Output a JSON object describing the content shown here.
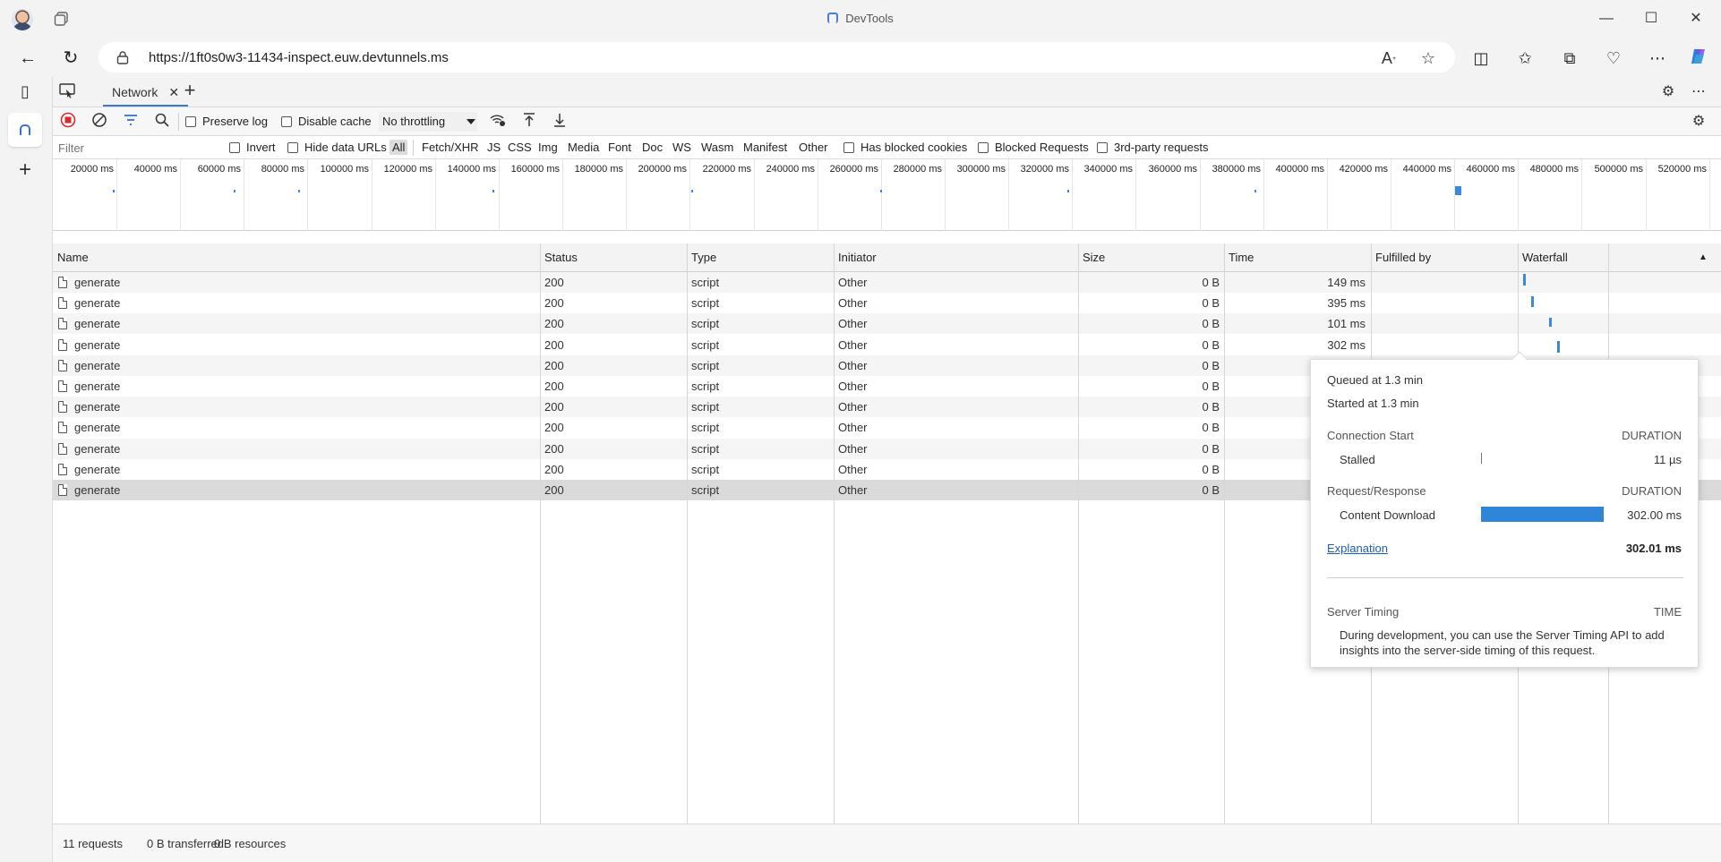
{
  "window": {
    "title": "DevTools"
  },
  "address": {
    "url": "https://1ft0s0w3-11434-inspect.euw.devtunnels.ms"
  },
  "devtools": {
    "tab_label": "Network",
    "toolbar": {
      "preserve_log": "Preserve log",
      "disable_cache": "Disable cache",
      "throttling": "No throttling"
    },
    "filter": {
      "placeholder": "Filter",
      "invert": "Invert",
      "hide_data_urls": "Hide data URLs",
      "types": [
        "All",
        "Fetch/XHR",
        "JS",
        "CSS",
        "Img",
        "Media",
        "Font",
        "Doc",
        "WS",
        "Wasm",
        "Manifest",
        "Other"
      ],
      "has_blocked_cookies": "Has blocked cookies",
      "blocked_requests": "Blocked Requests",
      "third_party": "3rd-party requests"
    },
    "overview_ticks": [
      "20000 ms",
      "40000 ms",
      "60000 ms",
      "80000 ms",
      "100000 ms",
      "120000 ms",
      "140000 ms",
      "160000 ms",
      "180000 ms",
      "200000 ms",
      "220000 ms",
      "240000 ms",
      "260000 ms",
      "280000 ms",
      "300000 ms",
      "320000 ms",
      "340000 ms",
      "360000 ms",
      "380000 ms",
      "400000 ms",
      "420000 ms",
      "440000 ms",
      "460000 ms",
      "480000 ms",
      "500000 ms",
      "520000 ms"
    ],
    "columns": [
      "Name",
      "Status",
      "Type",
      "Initiator",
      "Size",
      "Time",
      "Fulfilled by",
      "Waterfall"
    ],
    "rows": [
      {
        "name": "generate",
        "status": "200",
        "type": "script",
        "initiator": "Other",
        "size": "0 B",
        "time": "149 ms"
      },
      {
        "name": "generate",
        "status": "200",
        "type": "script",
        "initiator": "Other",
        "size": "0 B",
        "time": "395 ms"
      },
      {
        "name": "generate",
        "status": "200",
        "type": "script",
        "initiator": "Other",
        "size": "0 B",
        "time": "101 ms"
      },
      {
        "name": "generate",
        "status": "200",
        "type": "script",
        "initiator": "Other",
        "size": "0 B",
        "time": "302 ms"
      },
      {
        "name": "generate",
        "status": "200",
        "type": "script",
        "initiator": "Other",
        "size": "0 B",
        "time": ""
      },
      {
        "name": "generate",
        "status": "200",
        "type": "script",
        "initiator": "Other",
        "size": "0 B",
        "time": ""
      },
      {
        "name": "generate",
        "status": "200",
        "type": "script",
        "initiator": "Other",
        "size": "0 B",
        "time": ""
      },
      {
        "name": "generate",
        "status": "200",
        "type": "script",
        "initiator": "Other",
        "size": "0 B",
        "time": ""
      },
      {
        "name": "generate",
        "status": "200",
        "type": "script",
        "initiator": "Other",
        "size": "0 B",
        "time": ""
      },
      {
        "name": "generate",
        "status": "200",
        "type": "script",
        "initiator": "Other",
        "size": "0 B",
        "time": ""
      },
      {
        "name": "generate",
        "status": "200",
        "type": "script",
        "initiator": "Other",
        "size": "0 B",
        "time": ""
      }
    ],
    "status": {
      "requests": "11 requests",
      "transferred": "0 B transferred",
      "resources": "0 B resources"
    },
    "timing": {
      "queued": "Queued at 1.3 min",
      "started": "Started at 1.3 min",
      "connection_start": "Connection Start",
      "duration_label": "DURATION",
      "stalled": "Stalled",
      "stalled_value": "11 µs",
      "request_response": "Request/Response",
      "content_download": "Content Download",
      "content_download_value": "302.00 ms",
      "explanation": "Explanation",
      "total": "302.01 ms",
      "server_timing": "Server Timing",
      "time_label": "TIME",
      "server_timing_text_1": "During development, you can use the Server Timing API to add",
      "server_timing_text_2": "insights into the server-side timing of this request."
    }
  },
  "colors": {
    "accent": "#3b78d8",
    "bar": "#3b8ad9",
    "record": "#d32f2f"
  }
}
